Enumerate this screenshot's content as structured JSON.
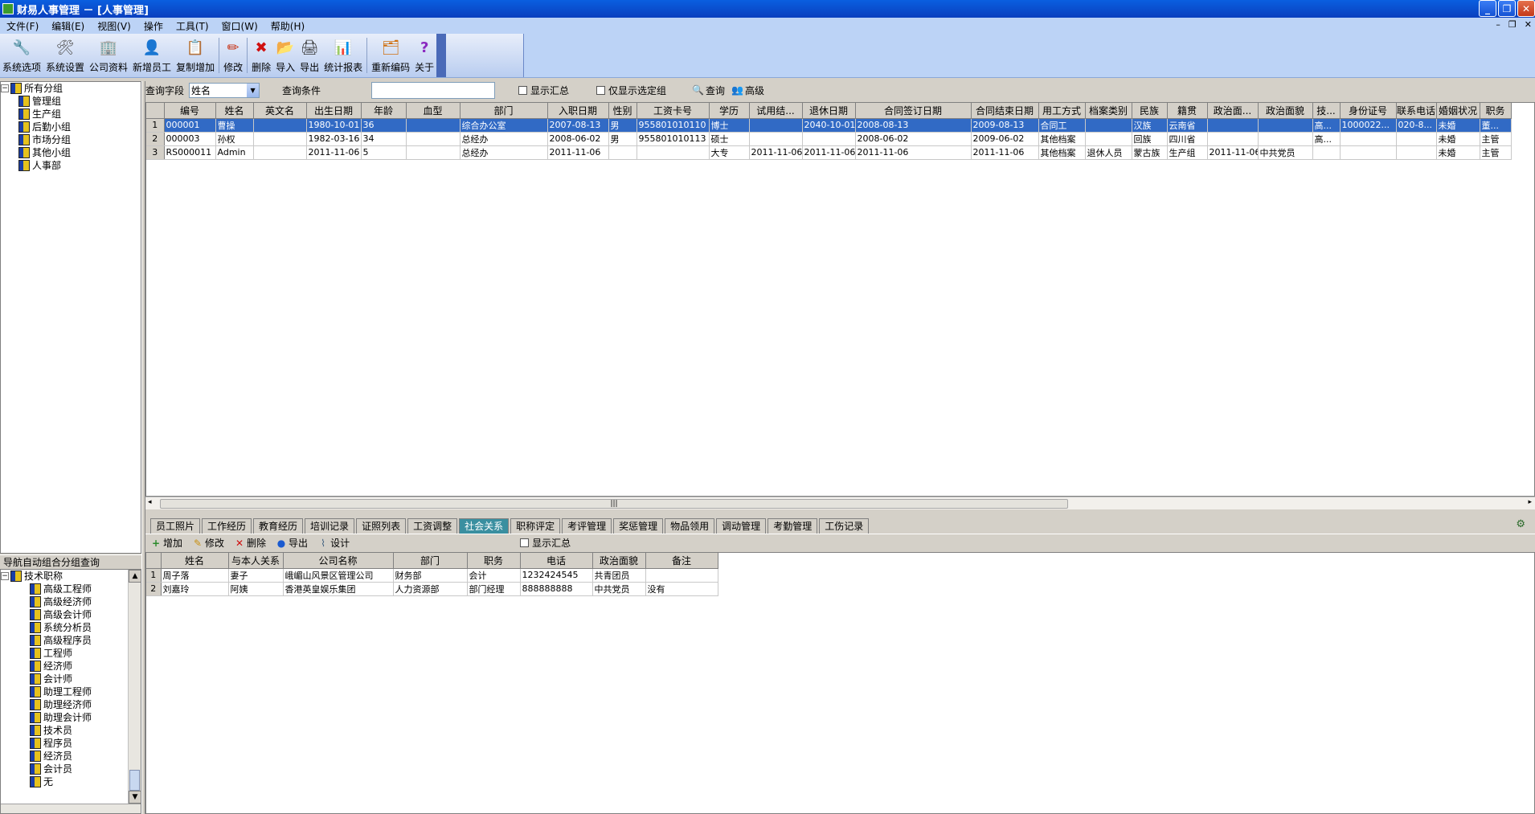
{
  "window": {
    "title": "财易人事管理 － [人事管理]"
  },
  "menu": [
    "文件(F)",
    "编辑(E)",
    "视图(V)",
    "操作",
    "工具(T)",
    "窗口(W)",
    "帮助(H)"
  ],
  "toolbar": [
    {
      "label": "系统选项",
      "icon": "wrench-icon",
      "glyph": "🔧"
    },
    {
      "label": "系统设置",
      "icon": "tools-icon",
      "glyph": "🛠"
    },
    {
      "label": "公司资料",
      "icon": "building-icon",
      "glyph": "🏢"
    },
    {
      "label": "新增员工",
      "icon": "add-user-icon",
      "glyph": "👤"
    },
    {
      "label": "复制增加",
      "icon": "copy-icon",
      "glyph": "📋"
    },
    {
      "label": "修改",
      "icon": "pencil-icon",
      "glyph": "✏"
    },
    {
      "label": "删除",
      "icon": "delete-icon",
      "glyph": "✖"
    },
    {
      "label": "导入",
      "icon": "import-icon",
      "glyph": "📂"
    },
    {
      "label": "导出",
      "icon": "export-icon",
      "glyph": "🖨"
    },
    {
      "label": "统计报表",
      "icon": "chart-icon",
      "glyph": "📊"
    },
    {
      "label": "重新编码",
      "icon": "recode-icon",
      "glyph": "🗂"
    },
    {
      "label": "关于",
      "icon": "help-icon",
      "glyph": "?"
    }
  ],
  "group_tree": {
    "root": "所有分组",
    "children": [
      "管理组",
      "生产组",
      "后勤小组",
      "市场分组",
      "其他小组",
      "人事部"
    ]
  },
  "nav": {
    "title": "导航自动组合分组查询",
    "root": "技术职称",
    "children": [
      "高级工程师",
      "高级经济师",
      "高级会计师",
      "系统分析员",
      "高级程序员",
      "工程师",
      "经济师",
      "会计师",
      "助理工程师",
      "助理经济师",
      "助理会计师",
      "技术员",
      "程序员",
      "经济员",
      "会计员",
      "无"
    ]
  },
  "query": {
    "field_label": "查询字段",
    "field_value": "姓名",
    "cond_label": "查询条件",
    "cond_value": "",
    "show_summary": "显示汇总",
    "only_selected": "仅显示选定组",
    "search": "查询",
    "advanced": "高级"
  },
  "main_table": {
    "columns": [
      "编号",
      "姓名",
      "英文名",
      "出生日期",
      "年龄",
      "血型",
      "部门",
      "入职日期",
      "性别",
      "工资卡号",
      "学历",
      "试用结...",
      "退休日期",
      "合同签订日期",
      "合同结束日期",
      "用工方式",
      "档案类别",
      "民族",
      "籍贯",
      "政治面...",
      "政治面貌",
      "技...",
      "身份证号",
      "联系电话",
      "婚姻状况",
      "职务"
    ],
    "rows": [
      [
        "000001",
        "曹操",
        "",
        "1980-10-01",
        "36",
        "",
        "综合办公室",
        "2007-08-13",
        "男",
        "955801010110",
        "博士",
        "",
        "2040-10-01",
        "2008-08-13",
        "2009-08-13",
        "合同工",
        "",
        "汉族",
        "云南省",
        "",
        "",
        "高...",
        "1000022...",
        "020-8...",
        "未婚",
        "董..."
      ],
      [
        "000003",
        "孙权",
        "",
        "1982-03-16",
        "34",
        "",
        "总经办",
        "2008-06-02",
        "男",
        "955801010113",
        "硕士",
        "",
        "",
        "2008-06-02",
        "2009-06-02",
        "其他档案",
        "",
        "回族",
        "四川省",
        "",
        "",
        "高...",
        "",
        "",
        "未婚",
        "主管"
      ],
      [
        "RS000011",
        "Admin",
        "",
        "2011-11-06",
        "5",
        "",
        "总经办",
        "2011-11-06",
        "",
        "",
        "大专",
        "2011-11-06",
        "2011-11-06",
        "2011-11-06",
        "2011-11-06",
        "其他档案",
        "退休人员",
        "蒙古族",
        "生产组",
        "2011-11-06",
        "中共党员",
        "",
        "",
        "",
        "未婚",
        "主管"
      ]
    ]
  },
  "tabs": [
    "员工照片",
    "工作经历",
    "教育经历",
    "培训记录",
    "证照列表",
    "工资调整",
    "社会关系",
    "职称评定",
    "考评管理",
    "奖惩管理",
    "物品领用",
    "调动管理",
    "考勤管理",
    "工伤记录"
  ],
  "active_tab": "社会关系",
  "sub_toolbar": {
    "add": "增加",
    "edit": "修改",
    "delete": "删除",
    "export": "导出",
    "design": "设计",
    "show_summary": "显示汇总"
  },
  "sub_table": {
    "columns": [
      "姓名",
      "与本人关系",
      "公司名称",
      "部门",
      "职务",
      "电话",
      "政治面貌",
      "备注"
    ],
    "rows": [
      [
        "周子落",
        "妻子",
        "峨嵋山风景区管理公司",
        "财务部",
        "会计",
        "1232424545",
        "共青团员",
        ""
      ],
      [
        "刘嘉玲",
        "阿姨",
        "香港英皇娱乐集团",
        "人力资源部",
        "部门经理",
        "888888888",
        "中共党员",
        "没有"
      ]
    ]
  }
}
